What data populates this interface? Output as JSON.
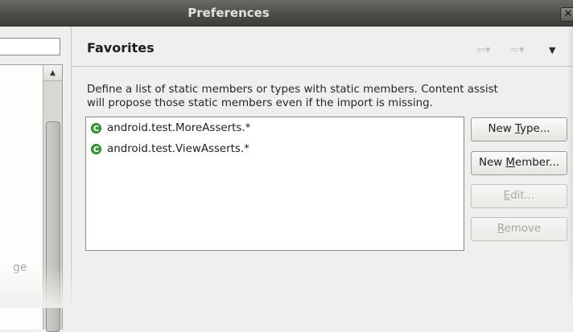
{
  "window": {
    "title": "Preferences",
    "close_icon": "close-icon"
  },
  "left_pane": {
    "filter_value": "",
    "tree_fragment": "ge"
  },
  "page": {
    "title": "Favorites",
    "nav": {
      "back_icon": "back-arrow-icon",
      "forward_icon": "forward-arrow-icon",
      "menu_icon": "view-menu-icon"
    },
    "description_line1": "Define a list of static members or types with static members. Content assist",
    "description_line2": "will propose those static members even if the import is missing.",
    "favorites": [
      {
        "icon": "class-icon",
        "label": "android.test.MoreAsserts.*"
      },
      {
        "icon": "class-icon",
        "label": "android.test.ViewAsserts.*"
      }
    ],
    "buttons": {
      "new_type": {
        "prefix": "New ",
        "mnemonic": "T",
        "suffix": "ype...",
        "enabled": true
      },
      "new_member": {
        "prefix": "New ",
        "mnemonic": "M",
        "suffix": "ember...",
        "enabled": true
      },
      "edit": {
        "prefix": "",
        "mnemonic": "E",
        "suffix": "dit...",
        "enabled": false
      },
      "remove": {
        "prefix": "",
        "mnemonic": "R",
        "suffix": "emove",
        "enabled": false
      }
    }
  },
  "colors": {
    "titlebar": "#4e4d48",
    "background": "#f0efed",
    "class_icon": "#3a9d3a",
    "disabled_text": "#a7a6a2"
  }
}
